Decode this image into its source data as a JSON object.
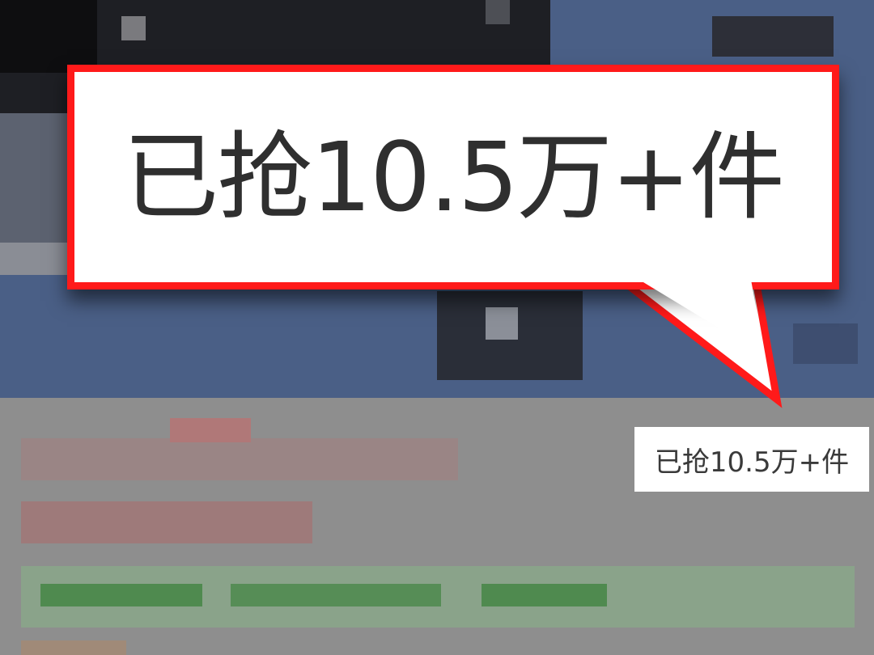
{
  "callout": {
    "text": "已抢10.5万+件",
    "border_color": "#ff1a1a"
  },
  "sales_badge": {
    "text": "已抢10.5万+件"
  },
  "colors": {
    "hero_background": "#4a5f86",
    "panel_background": "#8e8e8e"
  }
}
